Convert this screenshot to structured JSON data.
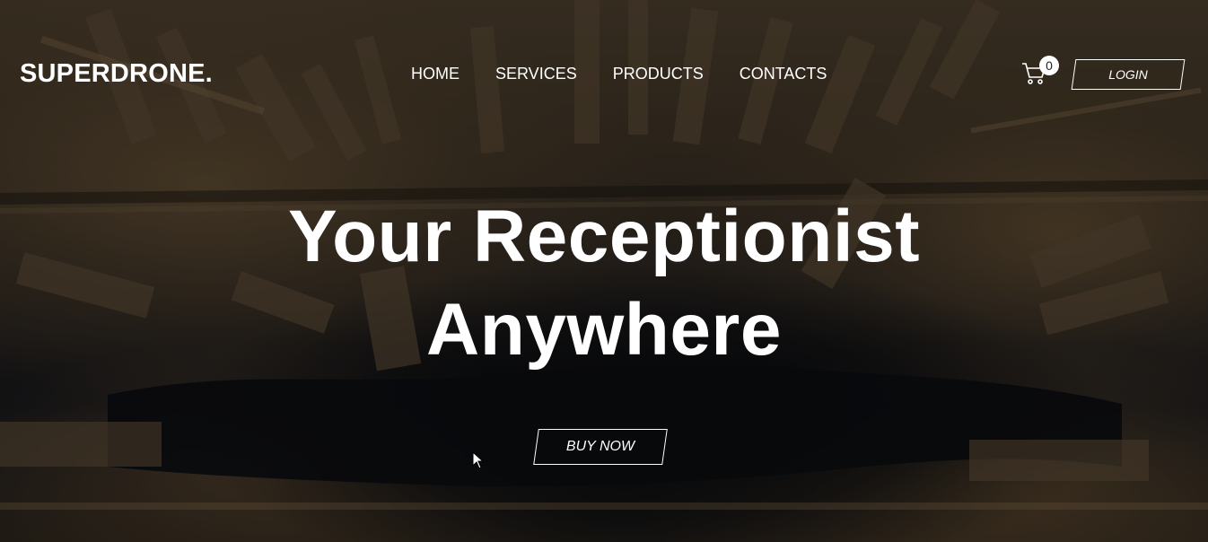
{
  "brand": {
    "logo": "SUPERDRONE."
  },
  "nav": {
    "items": [
      {
        "label": "HOME"
      },
      {
        "label": "SERVICES"
      },
      {
        "label": "PRODUCTS"
      },
      {
        "label": "CONTACTS"
      }
    ]
  },
  "cart": {
    "icon": "cart-icon",
    "count": "0"
  },
  "login": {
    "label": "LOGIN"
  },
  "hero": {
    "title_line1": "Your Receptionist",
    "title_line2": "Anywhere",
    "cta_label": "BUY NOW"
  },
  "colors": {
    "text": "#ffffff",
    "overlay": "#000000"
  }
}
